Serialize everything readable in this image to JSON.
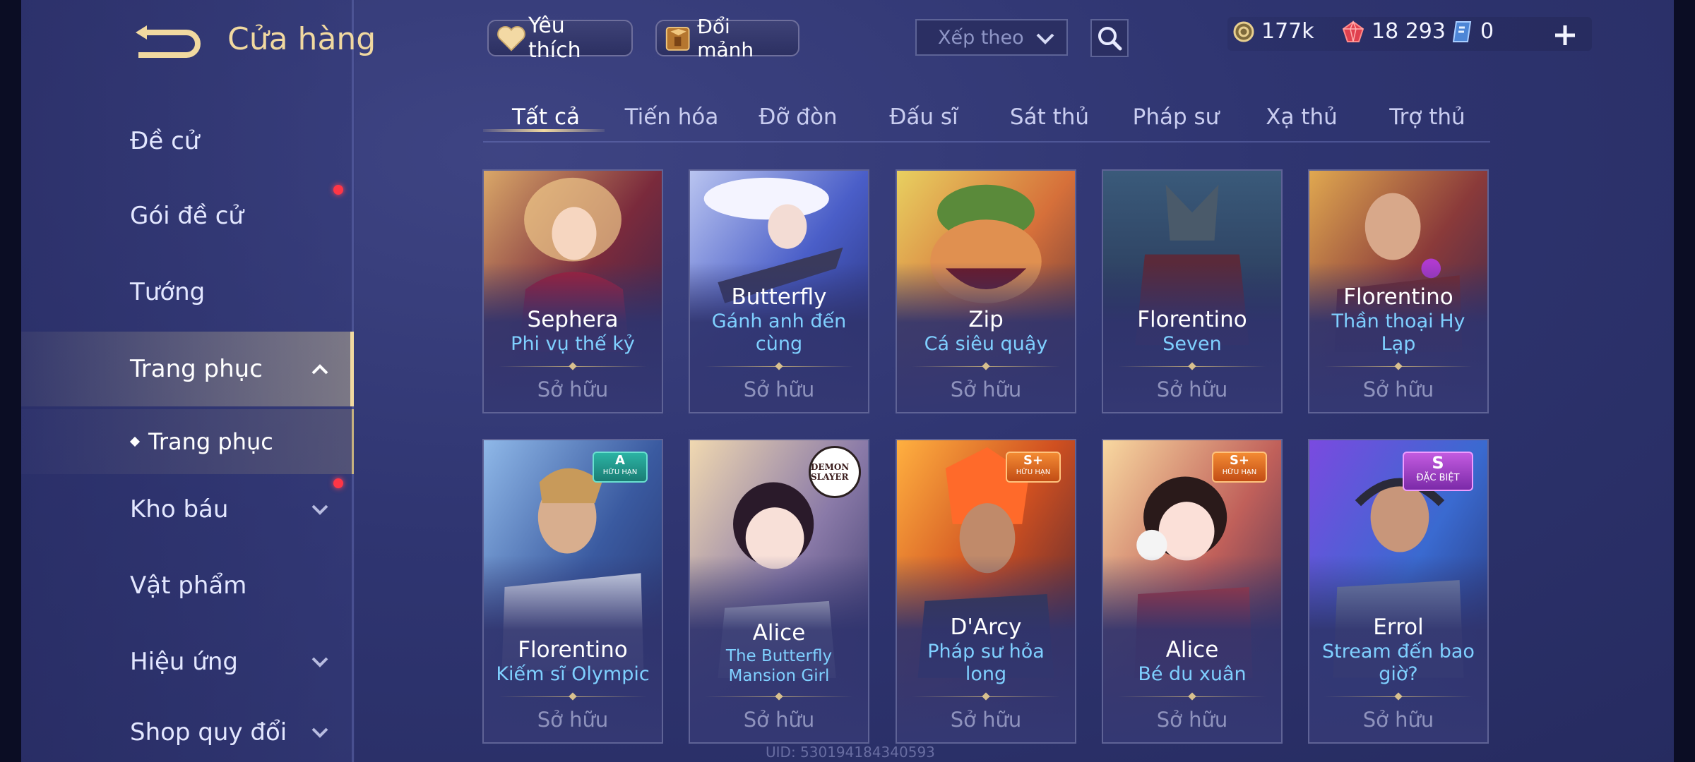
{
  "header": {
    "title": "Cửa hàng",
    "favorite_label": "Yêu thích",
    "exchange_label": "Đổi mảnh",
    "sort_placeholder": "Xếp theo"
  },
  "currencies": [
    {
      "name": "gold-coin",
      "value": "177k"
    },
    {
      "name": "red-gem",
      "value": "18 293"
    },
    {
      "name": "voucher",
      "value": "0"
    }
  ],
  "sidebar": {
    "items": [
      {
        "label": "Đề cử"
      },
      {
        "label": "Gói đề cử"
      },
      {
        "label": "Tướng"
      },
      {
        "label": "Trang phục"
      },
      {
        "label": "Kho báu"
      },
      {
        "label": "Vật phẩm"
      },
      {
        "label": "Hiệu ứng"
      },
      {
        "label": "Shop quy đổi"
      }
    ],
    "sub_item": "Trang phục"
  },
  "tabs": [
    "Tất cả",
    "Tiến hóa",
    "Đỡ đòn",
    "Đấu sĩ",
    "Sát thủ",
    "Pháp sư",
    "Xạ thủ",
    "Trợ thủ"
  ],
  "active_tab": "Tất cả",
  "cards": [
    {
      "hero": "Sephera",
      "skin": "Phi vụ thế kỷ",
      "status": "Sở hữu"
    },
    {
      "hero": "Butterfly",
      "skin": "Gánh anh đến cùng",
      "status": "Sở hữu"
    },
    {
      "hero": "Zip",
      "skin": "Cá siêu quậy",
      "status": "Sở hữu"
    },
    {
      "hero": "Florentino",
      "skin": "Seven",
      "status": "Sở hữu"
    },
    {
      "hero": "Florentino",
      "skin": "Thần thoại Hy Lạp",
      "status": "Sở hữu"
    },
    {
      "hero": "Florentino",
      "skin": "Kiếm sĩ Olympic",
      "status": "Sở hữu",
      "tier": "A",
      "tier_note": "HỮU HẠN"
    },
    {
      "hero": "Alice",
      "skin": "The Butterfly Mansion Girl",
      "status": "Sở hữu",
      "collab": "DEMON SLAYER"
    },
    {
      "hero": "D'Arcy",
      "skin": "Pháp sư hỏa long",
      "status": "Sở hữu",
      "tier": "S+",
      "tier_note": "HỮU HẠN"
    },
    {
      "hero": "Alice",
      "skin": "Bé du xuân",
      "status": "Sở hữu",
      "tier": "S+",
      "tier_note": "HỮU HẠN"
    },
    {
      "hero": "Errol",
      "skin": "Stream đến bao giờ?",
      "status": "Sở hữu",
      "tier": "S",
      "tier_note": "ĐẶC BIỆT"
    }
  ],
  "footer": {
    "uid": "UID: 530194184340593"
  },
  "colors": {
    "accent_gold": "#f1d9a0",
    "skin_name_blue": "#7fd0ff",
    "notification_red": "#ff3646"
  }
}
